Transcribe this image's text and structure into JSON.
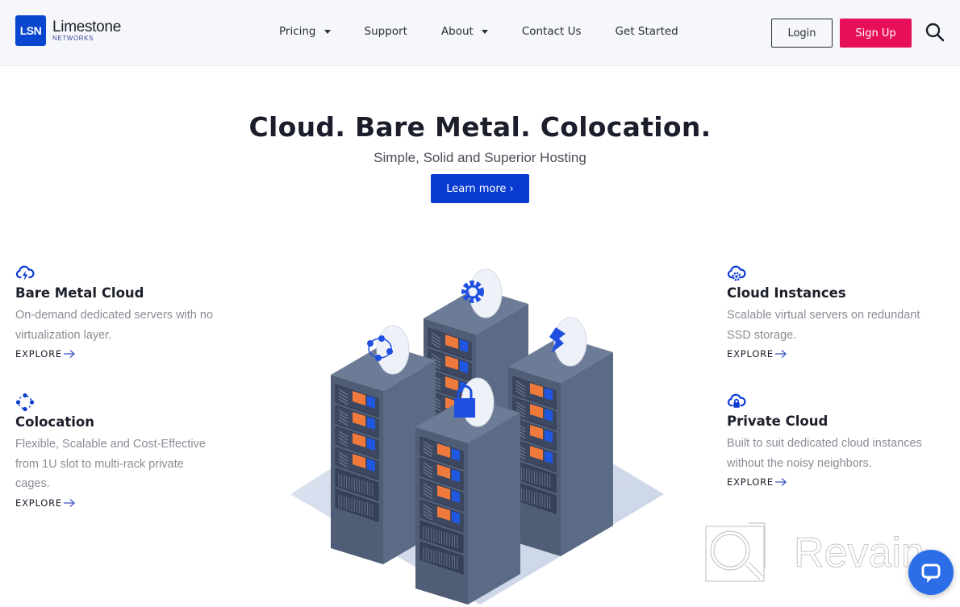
{
  "brand": {
    "badge": "LSN",
    "name": "Limestone",
    "sub": "NETWORKS"
  },
  "nav": {
    "items": [
      {
        "label": "Pricing",
        "dropdown": true
      },
      {
        "label": "Support",
        "dropdown": false
      },
      {
        "label": "About",
        "dropdown": true
      },
      {
        "label": "Contact Us",
        "dropdown": false
      },
      {
        "label": "Get Started",
        "dropdown": false
      }
    ],
    "login_label": "Login",
    "signup_label": "Sign Up"
  },
  "hero": {
    "title": "Cloud. Bare Metal. Colocation.",
    "subtitle": "Simple, Solid and Superior Hosting",
    "cta_label": "Learn more ›"
  },
  "features": {
    "left": [
      {
        "icon": "cloud-bolt-icon",
        "title": "Bare Metal Cloud",
        "desc_lines": [
          "On-demand dedicated servers with no",
          "virtualization layer."
        ],
        "explore": "EXPLORE"
      },
      {
        "icon": "colocation-nodes-icon",
        "title": "Colocation",
        "desc_lines": [
          "Flexible, Scalable and Cost-Effective",
          "from 1U slot to multi-rack private",
          "cages."
        ],
        "explore": "EXPLORE"
      }
    ],
    "right": [
      {
        "icon": "cloud-gear-icon",
        "title": "Cloud Instances",
        "desc_lines": [
          "Scalable virtual servers on redundant",
          "SSD storage."
        ],
        "explore": "EXPLORE"
      },
      {
        "icon": "cloud-lock-icon",
        "title": "Private Cloud",
        "desc_lines": [
          "Built to suit dedicated cloud instances",
          "without the noisy neighbors."
        ],
        "explore": "EXPLORE"
      }
    ]
  },
  "watermark": {
    "text": "Revain"
  },
  "colors": {
    "brand_blue": "#0a47d1",
    "cta_blue": "#0a3bd1",
    "signup_pink": "#e80f5a",
    "chat_blue": "#2b6ee8",
    "rack_gray": "#5b6b85",
    "led_orange": "#f07a3c"
  }
}
